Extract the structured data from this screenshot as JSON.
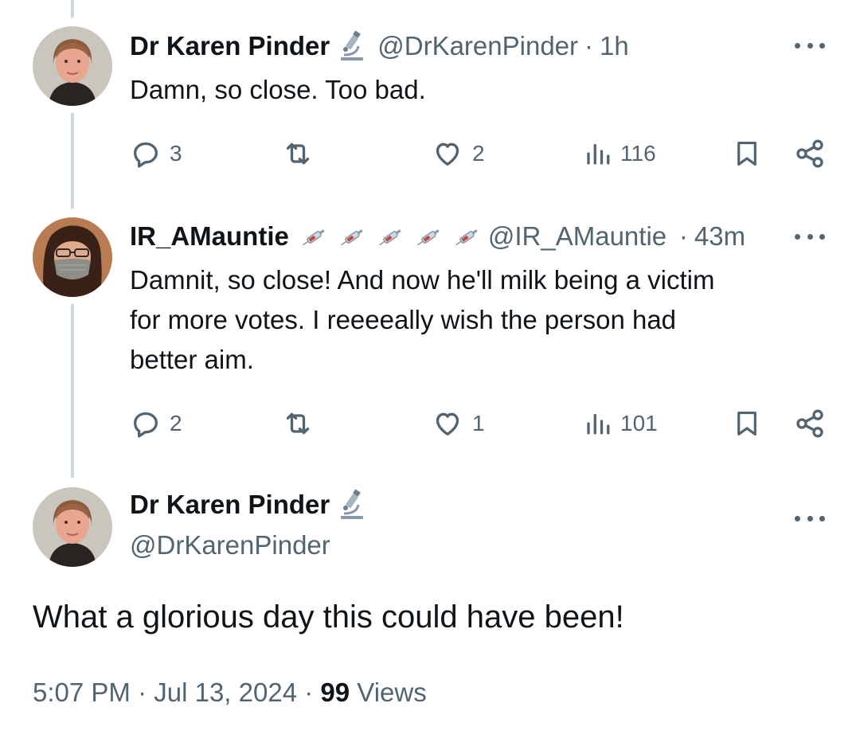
{
  "reply1": {
    "name": "Dr Karen Pinder",
    "badge_icon": "microscope-icon",
    "handle": "@DrKarenPinder",
    "separator": "·",
    "time": "1h",
    "text": "Damn, so close. Too bad.",
    "replies": "3",
    "likes": "2",
    "views": "116"
  },
  "reply2": {
    "name": "IR_AMauntie",
    "badge_icons": [
      "syringe-icon",
      "syringe-icon",
      "syringe-icon",
      "syringe-icon",
      "syringe-icon"
    ],
    "handle": "@IR_AMauntie",
    "separator": "·",
    "time": "43m",
    "text_line1": "Damnit, so close! And now he'll milk being a victim",
    "text_line2": "for more votes. I reeeeally wish the person had",
    "text_line3": "better aim.",
    "replies": "2",
    "likes": "1",
    "views": "101"
  },
  "main": {
    "name": "Dr Karen Pinder",
    "badge_icon": "microscope-icon",
    "handle": "@DrKarenPinder",
    "text": "What a glorious day this could have been!",
    "meta_time": "5:07 PM",
    "meta_sep1": "·",
    "meta_date": "Jul 13, 2024",
    "meta_sep2": "·",
    "views_count": "99",
    "views_label": "Views"
  },
  "colors": {
    "text_primary": "#0f1419",
    "text_secondary": "#536471",
    "thread_line": "#cfd9de"
  }
}
